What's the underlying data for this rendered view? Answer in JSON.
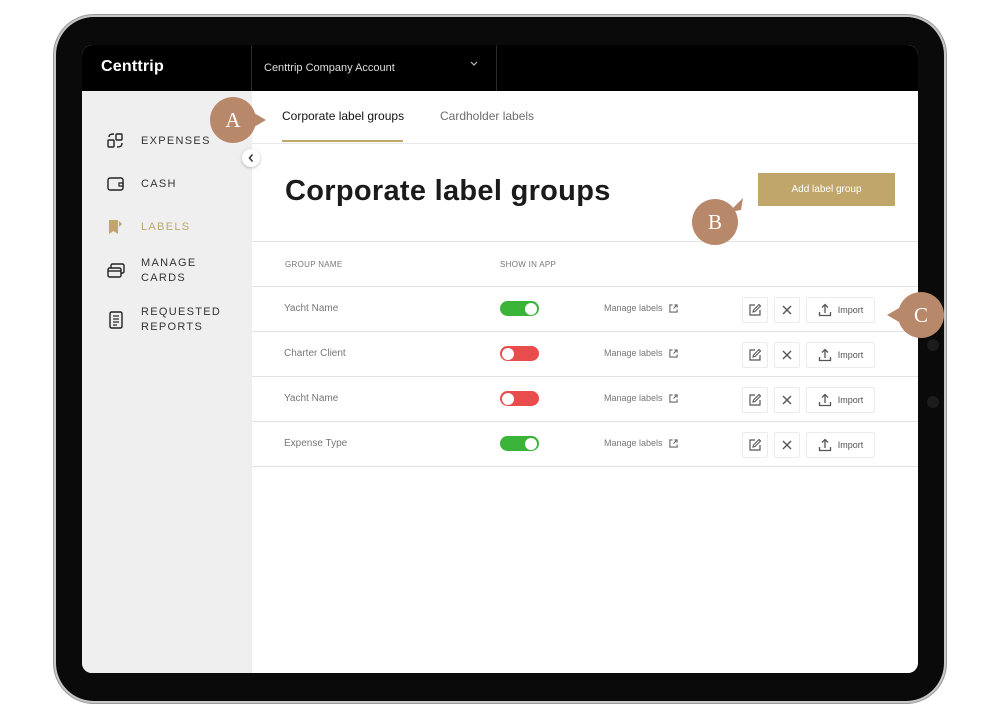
{
  "app": {
    "logo": "Centtrip",
    "account_selector": "Centtrip Company Account"
  },
  "sidebar": {
    "items": [
      {
        "label": "EXPENSES",
        "icon": "expenses-icon"
      },
      {
        "label": "CASH",
        "icon": "wallet-icon"
      },
      {
        "label": "LABELS",
        "icon": "label-icon",
        "active": true
      },
      {
        "label": "MANAGE CARDS",
        "icon": "cards-icon"
      },
      {
        "label": "REQUESTED REPORTS",
        "icon": "reports-icon"
      }
    ]
  },
  "tabs": [
    {
      "label": "Corporate label groups",
      "active": true
    },
    {
      "label": "Cardholder labels",
      "active": false
    }
  ],
  "main": {
    "title": "Corporate label groups",
    "add_button": "Add label group"
  },
  "table": {
    "columns": [
      "GROUP NAME",
      "SHOW IN APP"
    ],
    "rows": [
      {
        "name": "Yacht Name",
        "show_in_app": true,
        "manage": "Manage labels",
        "import": "Import"
      },
      {
        "name": "Charter Client",
        "show_in_app": false,
        "manage": "Manage labels",
        "import": "Import"
      },
      {
        "name": "Yacht Name",
        "show_in_app": false,
        "manage": "Manage labels",
        "import": "Import"
      },
      {
        "name": "Expense Type",
        "show_in_app": true,
        "manage": "Manage labels",
        "import": "Import"
      }
    ]
  },
  "callouts": {
    "a": "A",
    "b": "B",
    "c": "C"
  },
  "colors": {
    "accent": "#c0a66a",
    "toggle_on": "#3ab53a",
    "toggle_off": "#e84c4c",
    "callout": "#b8886b"
  }
}
